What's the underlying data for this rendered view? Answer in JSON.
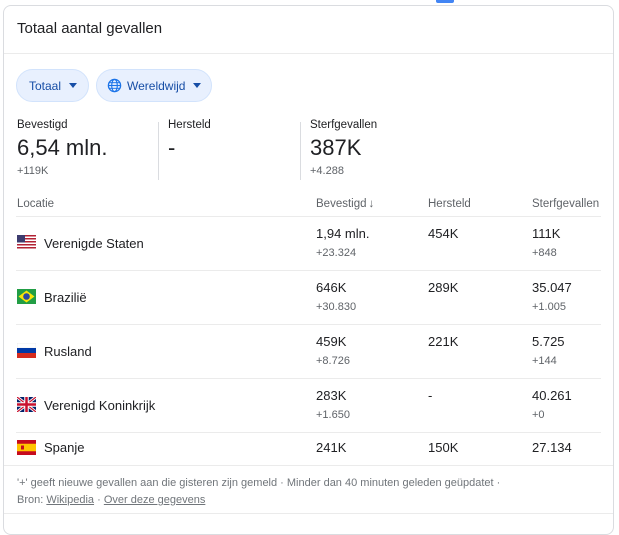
{
  "card": {
    "title": "Totaal aantal gevallen"
  },
  "filters": {
    "total": "Totaal",
    "region": "Wereldwijd"
  },
  "summary": [
    {
      "label": "Bevestigd",
      "value": "6,54 mln.",
      "delta": "+119K"
    },
    {
      "label": "Hersteld",
      "value": "-",
      "delta": ""
    },
    {
      "label": "Sterfgevallen",
      "value": "387K",
      "delta": "+4.288"
    }
  ],
  "table": {
    "headers": {
      "location": "Locatie",
      "confirmed": "Bevestigd",
      "recovered": "Hersteld",
      "deaths": "Sterfgevallen"
    },
    "rows": [
      {
        "country": "Verenigde Staten",
        "flag": "us-flag-icon",
        "confirmed": "1,94 mln.",
        "confirmed_delta": "+23.324",
        "recovered": "454K",
        "deaths": "111K",
        "deaths_delta": "+848"
      },
      {
        "country": "Brazilië",
        "flag": "br-flag-icon",
        "confirmed": "646K",
        "confirmed_delta": "+30.830",
        "recovered": "289K",
        "deaths": "35.047",
        "deaths_delta": "+1.005"
      },
      {
        "country": "Rusland",
        "flag": "ru-flag-icon",
        "confirmed": "459K",
        "confirmed_delta": "+8.726",
        "recovered": "221K",
        "deaths": "5.725",
        "deaths_delta": "+144"
      },
      {
        "country": "Verenigd Koninkrijk",
        "flag": "gb-flag-icon",
        "confirmed": "283K",
        "confirmed_delta": "+1.650",
        "recovered": "-",
        "deaths": "40.261",
        "deaths_delta": "+0"
      },
      {
        "country": "Spanje",
        "flag": "es-flag-icon",
        "confirmed": "241K",
        "confirmed_delta": "",
        "recovered": "150K",
        "deaths": "27.134",
        "deaths_delta": ""
      }
    ]
  },
  "footer": {
    "note": "'+' geeft nieuwe gevallen aan die gisteren zijn gemeld · Minder dan 40 minuten geleden geüpdatet ·",
    "source_label": "Bron:",
    "source_link": "Wikipedia",
    "separator": "·",
    "about_link": "Over deze gegevens"
  },
  "colors": {
    "chip_bg": "#e8f0fe",
    "chip_text": "#174ea6",
    "muted": "#5f6368"
  }
}
